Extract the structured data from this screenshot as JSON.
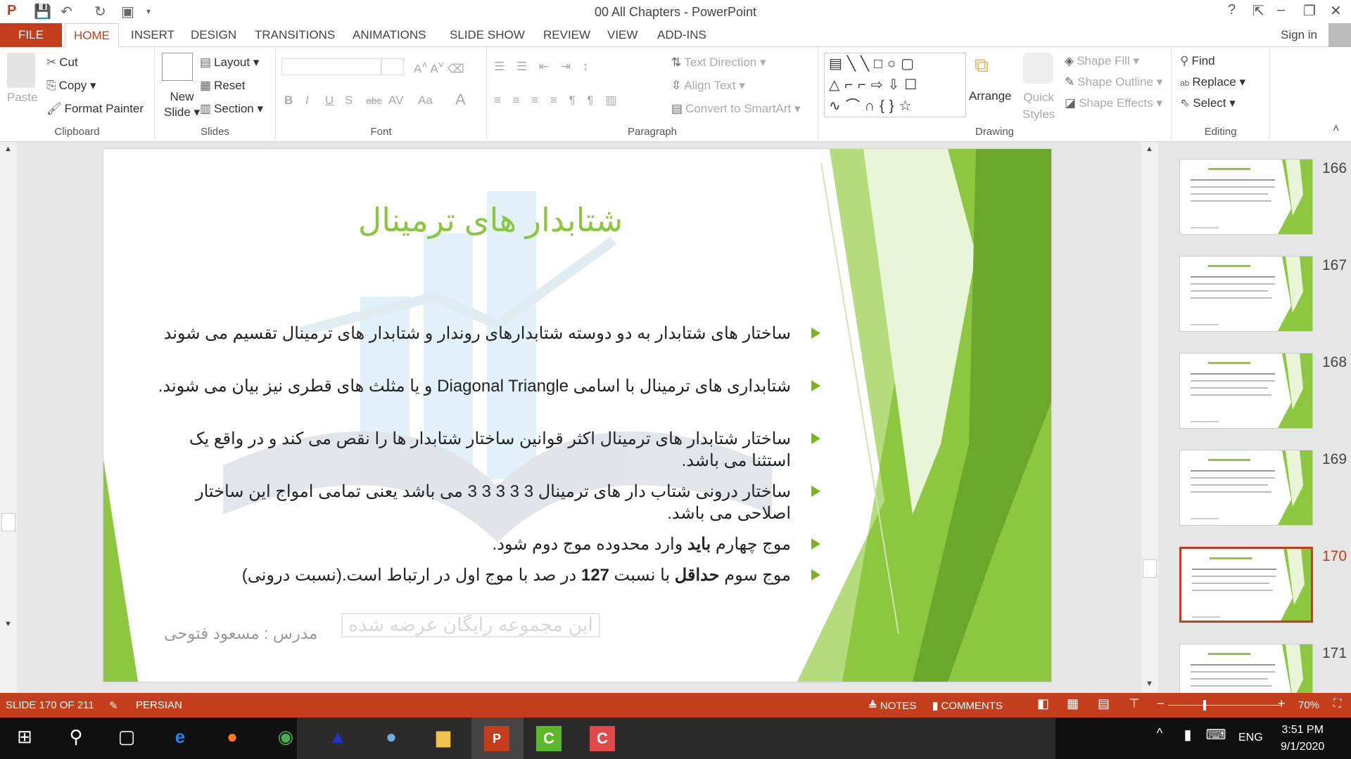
{
  "window": {
    "title": "00 All Chapters - PowerPoint",
    "help": "?",
    "sign_in": "Sign in"
  },
  "tabs": [
    "FILE",
    "HOME",
    "INSERT",
    "DESIGN",
    "TRANSITIONS",
    "ANIMATIONS",
    "SLIDE SHOW",
    "REVIEW",
    "VIEW",
    "ADD-INS"
  ],
  "ribbon": {
    "clipboard": {
      "label": "Clipboard",
      "paste": "Paste",
      "cut": "Cut",
      "copy": "Copy",
      "format_painter": "Format Painter"
    },
    "slides": {
      "label": "Slides",
      "new_slide_1": "New",
      "new_slide_2": "Slide",
      "layout": "Layout",
      "reset": "Reset",
      "section": "Section"
    },
    "font": {
      "label": "Font",
      "bold": "B",
      "italic": "I",
      "underline": "U",
      "shadow": "S",
      "strike": "abc",
      "spacing": "AV",
      "case": "Aa",
      "color": "A"
    },
    "paragraph": {
      "label": "Paragraph",
      "text_direction": "Text Direction",
      "align_text": "Align Text",
      "smartart": "Convert to SmartArt"
    },
    "drawing": {
      "label": "Drawing",
      "arrange": "Arrange",
      "quick_1": "Quick",
      "quick_2": "Styles",
      "shape_fill": "Shape Fill",
      "shape_outline": "Shape Outline",
      "shape_effects": "Shape Effects"
    },
    "editing": {
      "label": "Editing",
      "find": "Find",
      "replace": "Replace",
      "select": "Select"
    }
  },
  "slide": {
    "title": "شتابدار های ترمینال",
    "bullets": [
      "ساختار های شتابدار به دو دوسته شتابدارهای روندار و شتابدار های ترمینال تقسیم می شوند",
      "شتابداری های ترمینال با اسامی Diagonal Triangle و یا مثلث های قطری نیز بیان می شوند.",
      "ساختار شتابدار های ترمینال اکثر قوانین ساختار شتابدار ها را نقص می کند و در واقع یک استثنا می باشد.",
      "ساختار درونی شتاب دار های ترمینال 3 3 3 3 3 می باشد یعنی تمامی امواج این ساختار اصلاحی می باشد."
    ],
    "bullet5": {
      "a": "موج چهارم ",
      "b": "باید",
      "c": " وارد محدوده موج دوم شود."
    },
    "bullet6": {
      "a": "موج سوم ",
      "b": "حداقل",
      "c": "  با نسبت ",
      "d": "127",
      "e": " در صد با موج اول در ارتباط است.(نسبت درونی)"
    },
    "footer": "مدرس : مسعود فتوحی",
    "watermark": "این مجموعه رایگان عرضه شده",
    "accent": "#8cc63f"
  },
  "thumbnails": [
    {
      "num": "166"
    },
    {
      "num": "167"
    },
    {
      "num": "168"
    },
    {
      "num": "169"
    },
    {
      "num": "170",
      "selected": true
    },
    {
      "num": "171"
    }
  ],
  "status": {
    "slide": "SLIDE 170 OF 211",
    "language": "PERSIAN",
    "notes": "NOTES",
    "comments": "COMMENTS",
    "zoom": "70%",
    "zoom_percent": 70,
    "color": "#c43e1c"
  },
  "taskbar": {
    "time": "3:51 PM",
    "date": "9/1/2020",
    "lang": "ENG"
  }
}
